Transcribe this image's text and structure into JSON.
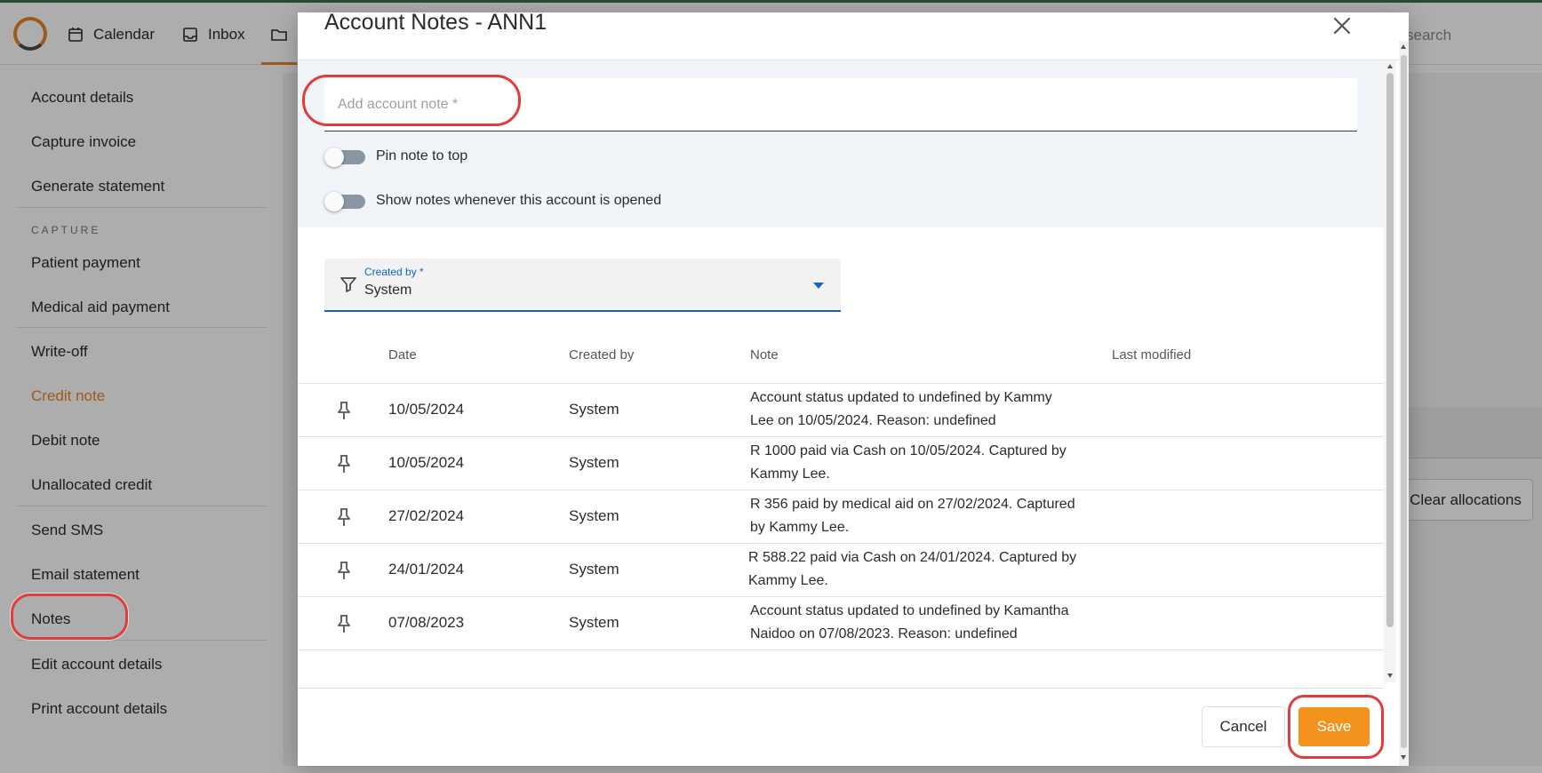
{
  "topbar": {
    "nav": [
      {
        "label": "Calendar",
        "icon": "calendar-icon"
      },
      {
        "label": "Inbox",
        "icon": "inbox-icon"
      },
      {
        "label": "",
        "icon": "folder-icon"
      }
    ],
    "search_fragment": "search"
  },
  "sidebar": {
    "items_top": [
      "Account details",
      "Capture invoice",
      "Generate statement"
    ],
    "section_label": "CAPTURE",
    "items_capture": [
      "Patient payment",
      "Medical aid payment",
      "Write-off",
      "Credit note",
      "Debit note",
      "Unallocated credit",
      "Send SMS",
      "Email statement",
      "Notes",
      "Edit account details",
      "Print account details"
    ],
    "active_item": "Credit note"
  },
  "background": {
    "clear_allocations_label": "Clear allocations"
  },
  "modal": {
    "title": "Account Notes - ANN1",
    "note_input": {
      "placeholder": "Add account note *",
      "value": ""
    },
    "toggles": [
      {
        "label": "Pin note to top",
        "checked": false
      },
      {
        "label": "Show notes whenever this account is opened",
        "checked": false
      }
    ],
    "filter": {
      "label": "Created by *",
      "value": "System",
      "icon": "filter-icon"
    },
    "table": {
      "columns": [
        "Date",
        "Created by",
        "Note",
        "Last modified"
      ],
      "rows": [
        {
          "date": "10/05/2024",
          "created_by": "System",
          "note_line1": "Account status updated to undefined by Kammy",
          "note_line2": "Lee on 10/05/2024. Reason: undefined",
          "last_modified": ""
        },
        {
          "date": "10/05/2024",
          "created_by": "System",
          "note_line1": "R 1000 paid via Cash on 10/05/2024. Captured by",
          "note_line2": "Kammy Lee.",
          "last_modified": ""
        },
        {
          "date": "27/02/2024",
          "created_by": "System",
          "note_line1": "R 356 paid by medical aid on 27/02/2024. Captured",
          "note_line2": "by Kammy Lee.",
          "last_modified": ""
        },
        {
          "date": "24/01/2024",
          "created_by": "System",
          "note_line1": "R 588.22 paid via Cash on 24/01/2024. Captured by",
          "note_line2": "Kammy Lee.",
          "last_modified": ""
        },
        {
          "date": "07/08/2023",
          "created_by": "System",
          "note_line1": "Account status updated to undefined by Kamantha",
          "note_line2": "Naidoo on 07/08/2023. Reason: undefined",
          "last_modified": ""
        }
      ]
    },
    "footer": {
      "cancel_label": "Cancel",
      "save_label": "Save"
    }
  },
  "colors": {
    "accent_orange": "#f4921e",
    "active_link": "#e8852b",
    "focus_blue": "#1565c0",
    "highlight_red": "#e23b3b"
  }
}
